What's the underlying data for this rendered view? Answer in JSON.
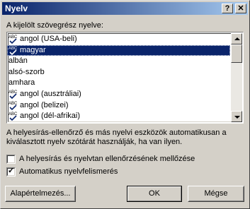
{
  "window": {
    "title": "Nyelv",
    "help_label": "?",
    "close_label": "✕"
  },
  "list": {
    "caption": "A kijelölt szövegrész nyelve:",
    "items": [
      {
        "label": "angol (USA-beli)",
        "spell": true,
        "selected": false
      },
      {
        "label": "magyar",
        "spell": true,
        "selected": true
      },
      {
        "label": "albán",
        "spell": false,
        "selected": false
      },
      {
        "label": "alsó-szorb",
        "spell": false,
        "selected": false
      },
      {
        "label": "amhara",
        "spell": false,
        "selected": false
      },
      {
        "label": "angol (ausztráliai)",
        "spell": true,
        "selected": false
      },
      {
        "label": "angol (belizei)",
        "spell": true,
        "selected": false
      },
      {
        "label": "angol (dél-afrikai)",
        "spell": true,
        "selected": false
      }
    ],
    "spell_icon_text": "ABC"
  },
  "description": {
    "line1": "A helyesírás-ellenőrző és más nyelvi eszközök automatikusan a",
    "line2": "kiválasztott nyelv szótárát használják, ha van ilyen."
  },
  "options": {
    "skip_spellcheck": {
      "label": "A helyesírás és nyelvtan ellenőrzésének mellőzése",
      "checked": false
    },
    "auto_detect": {
      "label": "Automatikus nyelvfelismerés",
      "checked": true
    }
  },
  "buttons": {
    "default_label": "Alapértelmezés...",
    "ok_label": "OK",
    "cancel_label": "Mégse"
  }
}
